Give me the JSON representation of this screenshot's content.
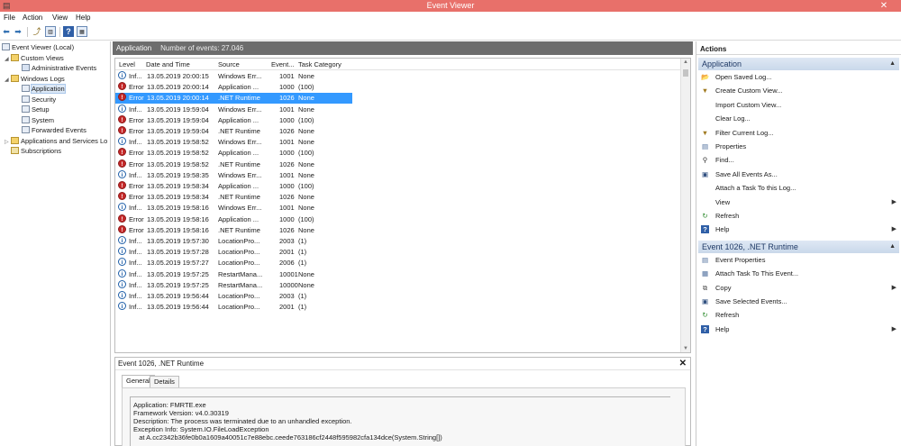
{
  "window": {
    "title": "Event Viewer",
    "close_glyph": "✕"
  },
  "menu": [
    "File",
    "Action",
    "View",
    "Help"
  ],
  "tree": {
    "items": [
      {
        "label": "Event Viewer (Local)",
        "icon": "computer-icon"
      },
      {
        "label": "Custom Views",
        "icon": "folder-icon"
      },
      {
        "label": "Administrative Events",
        "icon": "filter-icon"
      },
      {
        "label": "Windows Logs",
        "icon": "folder-icon"
      },
      {
        "label": "Application",
        "icon": "log-icon"
      },
      {
        "label": "Security",
        "icon": "log-icon"
      },
      {
        "label": "Setup",
        "icon": "log-icon"
      },
      {
        "label": "System",
        "icon": "log-icon"
      },
      {
        "label": "Forwarded Events",
        "icon": "log-icon"
      },
      {
        "label": "Applications and Services Lo",
        "icon": "folder-icon"
      },
      {
        "label": "Subscriptions",
        "icon": "subscriptions-icon"
      }
    ]
  },
  "center": {
    "header_title": "Application",
    "header_count": "Number of events: 27.046",
    "columns": [
      "Level",
      "Date and Time",
      "Source",
      "Event...",
      "Task Category"
    ],
    "rows": [
      {
        "level": "Inf...",
        "type": "info",
        "date": "13.05.2019 20:00:15",
        "source": "Windows Err...",
        "event": "1001",
        "task": "None"
      },
      {
        "level": "Error",
        "type": "error",
        "date": "13.05.2019 20:00:14",
        "source": "Application ...",
        "event": "1000",
        "task": "(100)"
      },
      {
        "level": "Error",
        "type": "error",
        "date": "13.05.2019 20:00:14",
        "source": ".NET Runtime",
        "event": "1026",
        "task": "None"
      },
      {
        "level": "Inf...",
        "type": "info",
        "date": "13.05.2019 19:59:04",
        "source": "Windows Err...",
        "event": "1001",
        "task": "None"
      },
      {
        "level": "Error",
        "type": "error",
        "date": "13.05.2019 19:59:04",
        "source": "Application ...",
        "event": "1000",
        "task": "(100)"
      },
      {
        "level": "Error",
        "type": "error",
        "date": "13.05.2019 19:59:04",
        "source": ".NET Runtime",
        "event": "1026",
        "task": "None"
      },
      {
        "level": "Inf...",
        "type": "info",
        "date": "13.05.2019 19:58:52",
        "source": "Windows Err...",
        "event": "1001",
        "task": "None"
      },
      {
        "level": "Error",
        "type": "error",
        "date": "13.05.2019 19:58:52",
        "source": "Application ...",
        "event": "1000",
        "task": "(100)"
      },
      {
        "level": "Error",
        "type": "error",
        "date": "13.05.2019 19:58:52",
        "source": ".NET Runtime",
        "event": "1026",
        "task": "None"
      },
      {
        "level": "Inf...",
        "type": "info",
        "date": "13.05.2019 19:58:35",
        "source": "Windows Err...",
        "event": "1001",
        "task": "None"
      },
      {
        "level": "Error",
        "type": "error",
        "date": "13.05.2019 19:58:34",
        "source": "Application ...",
        "event": "1000",
        "task": "(100)"
      },
      {
        "level": "Error",
        "type": "error",
        "date": "13.05.2019 19:58:34",
        "source": ".NET Runtime",
        "event": "1026",
        "task": "None"
      },
      {
        "level": "Inf...",
        "type": "info",
        "date": "13.05.2019 19:58:16",
        "source": "Windows Err...",
        "event": "1001",
        "task": "None"
      },
      {
        "level": "Error",
        "type": "error",
        "date": "13.05.2019 19:58:16",
        "source": "Application ...",
        "event": "1000",
        "task": "(100)"
      },
      {
        "level": "Error",
        "type": "error",
        "date": "13.05.2019 19:58:16",
        "source": ".NET Runtime",
        "event": "1026",
        "task": "None"
      },
      {
        "level": "Inf...",
        "type": "info",
        "date": "13.05.2019 19:57:30",
        "source": "LocationPro...",
        "event": "2003",
        "task": "(1)"
      },
      {
        "level": "Inf...",
        "type": "info",
        "date": "13.05.2019 19:57:28",
        "source": "LocationPro...",
        "event": "2001",
        "task": "(1)"
      },
      {
        "level": "Inf...",
        "type": "info",
        "date": "13.05.2019 19:57:27",
        "source": "LocationPro...",
        "event": "2006",
        "task": "(1)"
      },
      {
        "level": "Inf...",
        "type": "info",
        "date": "13.05.2019 19:57:25",
        "source": "RestartMana...",
        "event": "10001",
        "task": "None"
      },
      {
        "level": "Inf...",
        "type": "info",
        "date": "13.05.2019 19:57:25",
        "source": "RestartMana...",
        "event": "10000",
        "task": "None"
      },
      {
        "level": "Inf...",
        "type": "info",
        "date": "13.05.2019 19:56:44",
        "source": "LocationPro...",
        "event": "2003",
        "task": "(1)"
      },
      {
        "level": "Inf...",
        "type": "info",
        "date": "13.05.2019 19:56:44",
        "source": "LocationPro...",
        "event": "2001",
        "task": "(1)"
      }
    ],
    "selected_row": 2
  },
  "detail": {
    "title": "Event 1026, .NET Runtime",
    "close_glyph": "✕",
    "tabs": [
      "General",
      "Details"
    ],
    "lines": [
      "Application: FMRTE.exe",
      "Framework Version: v4.0.30319",
      "Description: The process was terminated due to an unhandled exception.",
      "Exception Info: System.IO.FileLoadException",
      "   at A.cc2342b36fe0b0a1609a40051c7e88ebc.ceede763186cf2448f595982cfa134dce(System.String[])"
    ]
  },
  "actions": {
    "title": "Actions",
    "sections": [
      {
        "header": "Application",
        "items": [
          {
            "label": "Open Saved Log...",
            "icon": "open-folder-icon",
            "submenu": false
          },
          {
            "label": "Create Custom View...",
            "icon": "filter-icon",
            "submenu": false
          },
          {
            "label": "Import Custom View...",
            "icon": "",
            "submenu": false
          },
          {
            "label": "Clear Log...",
            "icon": "",
            "submenu": false
          },
          {
            "label": "Filter Current Log...",
            "icon": "filter-icon",
            "submenu": false
          },
          {
            "label": "Properties",
            "icon": "properties-icon",
            "submenu": false
          },
          {
            "label": "Find...",
            "icon": "binoculars-icon",
            "submenu": false
          },
          {
            "label": "Save All Events As...",
            "icon": "save-icon",
            "submenu": false
          },
          {
            "label": "Attach a Task To this Log...",
            "icon": "",
            "submenu": false
          },
          {
            "label": "View",
            "icon": "",
            "submenu": true
          },
          {
            "label": "Refresh",
            "icon": "refresh-icon",
            "submenu": false
          },
          {
            "label": "Help",
            "icon": "help-icon",
            "submenu": true
          }
        ]
      },
      {
        "header": "Event 1026, .NET Runtime",
        "items": [
          {
            "label": "Event Properties",
            "icon": "properties-icon",
            "submenu": false
          },
          {
            "label": "Attach Task To This Event...",
            "icon": "task-icon",
            "submenu": false
          },
          {
            "label": "Copy",
            "icon": "copy-icon",
            "submenu": true
          },
          {
            "label": "Save Selected Events...",
            "icon": "save-icon",
            "submenu": false
          },
          {
            "label": "Refresh",
            "icon": "refresh-icon",
            "submenu": false
          },
          {
            "label": "Help",
            "icon": "help-icon",
            "submenu": true
          }
        ]
      }
    ]
  },
  "colors": {
    "titlebar": "#e8706a",
    "selection": "#3399ff",
    "error": "#c62828",
    "info": "#1f5fa8"
  }
}
